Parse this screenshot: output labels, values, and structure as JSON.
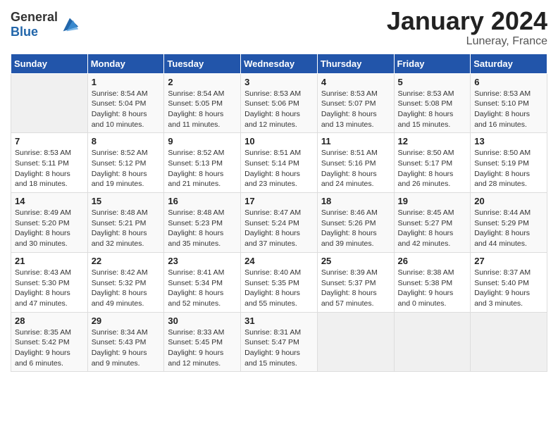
{
  "header": {
    "logo_general": "General",
    "logo_blue": "Blue",
    "month_title": "January 2024",
    "location": "Luneray, France"
  },
  "days_of_week": [
    "Sunday",
    "Monday",
    "Tuesday",
    "Wednesday",
    "Thursday",
    "Friday",
    "Saturday"
  ],
  "weeks": [
    [
      {
        "day": "",
        "sunrise": "",
        "sunset": "",
        "daylight": ""
      },
      {
        "day": "1",
        "sunrise": "Sunrise: 8:54 AM",
        "sunset": "Sunset: 5:04 PM",
        "daylight": "Daylight: 8 hours and 10 minutes."
      },
      {
        "day": "2",
        "sunrise": "Sunrise: 8:54 AM",
        "sunset": "Sunset: 5:05 PM",
        "daylight": "Daylight: 8 hours and 11 minutes."
      },
      {
        "day": "3",
        "sunrise": "Sunrise: 8:53 AM",
        "sunset": "Sunset: 5:06 PM",
        "daylight": "Daylight: 8 hours and 12 minutes."
      },
      {
        "day": "4",
        "sunrise": "Sunrise: 8:53 AM",
        "sunset": "Sunset: 5:07 PM",
        "daylight": "Daylight: 8 hours and 13 minutes."
      },
      {
        "day": "5",
        "sunrise": "Sunrise: 8:53 AM",
        "sunset": "Sunset: 5:08 PM",
        "daylight": "Daylight: 8 hours and 15 minutes."
      },
      {
        "day": "6",
        "sunrise": "Sunrise: 8:53 AM",
        "sunset": "Sunset: 5:10 PM",
        "daylight": "Daylight: 8 hours and 16 minutes."
      }
    ],
    [
      {
        "day": "7",
        "sunrise": "Sunrise: 8:53 AM",
        "sunset": "Sunset: 5:11 PM",
        "daylight": "Daylight: 8 hours and 18 minutes."
      },
      {
        "day": "8",
        "sunrise": "Sunrise: 8:52 AM",
        "sunset": "Sunset: 5:12 PM",
        "daylight": "Daylight: 8 hours and 19 minutes."
      },
      {
        "day": "9",
        "sunrise": "Sunrise: 8:52 AM",
        "sunset": "Sunset: 5:13 PM",
        "daylight": "Daylight: 8 hours and 21 minutes."
      },
      {
        "day": "10",
        "sunrise": "Sunrise: 8:51 AM",
        "sunset": "Sunset: 5:14 PM",
        "daylight": "Daylight: 8 hours and 23 minutes."
      },
      {
        "day": "11",
        "sunrise": "Sunrise: 8:51 AM",
        "sunset": "Sunset: 5:16 PM",
        "daylight": "Daylight: 8 hours and 24 minutes."
      },
      {
        "day": "12",
        "sunrise": "Sunrise: 8:50 AM",
        "sunset": "Sunset: 5:17 PM",
        "daylight": "Daylight: 8 hours and 26 minutes."
      },
      {
        "day": "13",
        "sunrise": "Sunrise: 8:50 AM",
        "sunset": "Sunset: 5:19 PM",
        "daylight": "Daylight: 8 hours and 28 minutes."
      }
    ],
    [
      {
        "day": "14",
        "sunrise": "Sunrise: 8:49 AM",
        "sunset": "Sunset: 5:20 PM",
        "daylight": "Daylight: 8 hours and 30 minutes."
      },
      {
        "day": "15",
        "sunrise": "Sunrise: 8:48 AM",
        "sunset": "Sunset: 5:21 PM",
        "daylight": "Daylight: 8 hours and 32 minutes."
      },
      {
        "day": "16",
        "sunrise": "Sunrise: 8:48 AM",
        "sunset": "Sunset: 5:23 PM",
        "daylight": "Daylight: 8 hours and 35 minutes."
      },
      {
        "day": "17",
        "sunrise": "Sunrise: 8:47 AM",
        "sunset": "Sunset: 5:24 PM",
        "daylight": "Daylight: 8 hours and 37 minutes."
      },
      {
        "day": "18",
        "sunrise": "Sunrise: 8:46 AM",
        "sunset": "Sunset: 5:26 PM",
        "daylight": "Daylight: 8 hours and 39 minutes."
      },
      {
        "day": "19",
        "sunrise": "Sunrise: 8:45 AM",
        "sunset": "Sunset: 5:27 PM",
        "daylight": "Daylight: 8 hours and 42 minutes."
      },
      {
        "day": "20",
        "sunrise": "Sunrise: 8:44 AM",
        "sunset": "Sunset: 5:29 PM",
        "daylight": "Daylight: 8 hours and 44 minutes."
      }
    ],
    [
      {
        "day": "21",
        "sunrise": "Sunrise: 8:43 AM",
        "sunset": "Sunset: 5:30 PM",
        "daylight": "Daylight: 8 hours and 47 minutes."
      },
      {
        "day": "22",
        "sunrise": "Sunrise: 8:42 AM",
        "sunset": "Sunset: 5:32 PM",
        "daylight": "Daylight: 8 hours and 49 minutes."
      },
      {
        "day": "23",
        "sunrise": "Sunrise: 8:41 AM",
        "sunset": "Sunset: 5:34 PM",
        "daylight": "Daylight: 8 hours and 52 minutes."
      },
      {
        "day": "24",
        "sunrise": "Sunrise: 8:40 AM",
        "sunset": "Sunset: 5:35 PM",
        "daylight": "Daylight: 8 hours and 55 minutes."
      },
      {
        "day": "25",
        "sunrise": "Sunrise: 8:39 AM",
        "sunset": "Sunset: 5:37 PM",
        "daylight": "Daylight: 8 hours and 57 minutes."
      },
      {
        "day": "26",
        "sunrise": "Sunrise: 8:38 AM",
        "sunset": "Sunset: 5:38 PM",
        "daylight": "Daylight: 9 hours and 0 minutes."
      },
      {
        "day": "27",
        "sunrise": "Sunrise: 8:37 AM",
        "sunset": "Sunset: 5:40 PM",
        "daylight": "Daylight: 9 hours and 3 minutes."
      }
    ],
    [
      {
        "day": "28",
        "sunrise": "Sunrise: 8:35 AM",
        "sunset": "Sunset: 5:42 PM",
        "daylight": "Daylight: 9 hours and 6 minutes."
      },
      {
        "day": "29",
        "sunrise": "Sunrise: 8:34 AM",
        "sunset": "Sunset: 5:43 PM",
        "daylight": "Daylight: 9 hours and 9 minutes."
      },
      {
        "day": "30",
        "sunrise": "Sunrise: 8:33 AM",
        "sunset": "Sunset: 5:45 PM",
        "daylight": "Daylight: 9 hours and 12 minutes."
      },
      {
        "day": "31",
        "sunrise": "Sunrise: 8:31 AM",
        "sunset": "Sunset: 5:47 PM",
        "daylight": "Daylight: 9 hours and 15 minutes."
      },
      {
        "day": "",
        "sunrise": "",
        "sunset": "",
        "daylight": ""
      },
      {
        "day": "",
        "sunrise": "",
        "sunset": "",
        "daylight": ""
      },
      {
        "day": "",
        "sunrise": "",
        "sunset": "",
        "daylight": ""
      }
    ]
  ]
}
